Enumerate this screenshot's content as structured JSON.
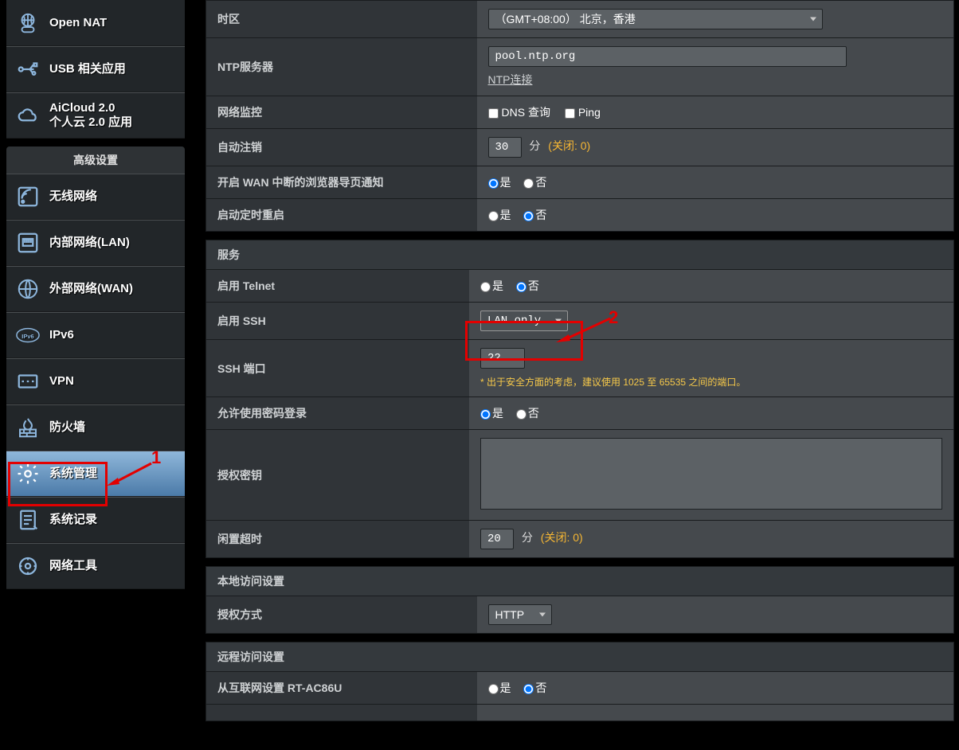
{
  "sidebar": {
    "top_items": [
      {
        "label": "Open NAT",
        "icon": "gamepad-globe-icon"
      },
      {
        "label": "USB 相关应用",
        "icon": "usb-icon"
      },
      {
        "label": "AiCloud 2.0\n个人云 2.0 应用",
        "icon": "cloud-icon"
      }
    ],
    "advanced_header": "高级设置",
    "items": [
      {
        "label": "无线网络",
        "icon": "wifi-icon"
      },
      {
        "label": "内部网络(LAN)",
        "icon": "lan-icon"
      },
      {
        "label": "外部网络(WAN)",
        "icon": "globe-icon"
      },
      {
        "label": "IPv6",
        "icon": "ipv6-icon"
      },
      {
        "label": "VPN",
        "icon": "vpn-icon"
      },
      {
        "label": "防火墙",
        "icon": "firewall-icon"
      },
      {
        "label": "系统管理",
        "icon": "gear-icon"
      },
      {
        "label": "系统记录",
        "icon": "log-icon"
      },
      {
        "label": "网络工具",
        "icon": "tools-icon"
      }
    ],
    "active_index": 6
  },
  "main": {
    "rows": {
      "timezone": {
        "label": "时区",
        "value": "（GMT+08:00） 北京，香港"
      },
      "ntp_server": {
        "label": "NTP服务器",
        "value": "pool.ntp.org",
        "link": "NTP连接"
      },
      "net_monitor": {
        "label": "网络监控",
        "chk1": "DNS 查询",
        "chk2": "Ping"
      },
      "auto_logout": {
        "label": "自动注销",
        "value": "30",
        "unit": "分",
        "hint": "(关闭: 0)"
      },
      "wan_notify": {
        "label": "开启 WAN 中断的浏览器导页通知",
        "yes": "是",
        "no": "否",
        "selected": "yes"
      },
      "sched_reboot": {
        "label": "启动定时重启",
        "yes": "是",
        "no": "否",
        "selected": "no"
      }
    },
    "service_header": "服务",
    "service": {
      "telnet": {
        "label": "启用 Telnet",
        "yes": "是",
        "no": "否",
        "selected": "no"
      },
      "ssh": {
        "label": "启用 SSH",
        "value": "LAN only"
      },
      "ssh_port": {
        "label": "SSH 端口",
        "value": "22",
        "note": "* 出于安全方面的考虑，建议使用 1025 至 65535 之间的端口。"
      },
      "pw_login": {
        "label": "允许使用密码登录",
        "yes": "是",
        "no": "否",
        "selected": "yes"
      },
      "auth_key": {
        "label": "授权密钥",
        "value": ""
      },
      "idle_timeout": {
        "label": "闲置超时",
        "value": "20",
        "unit": "分",
        "hint": "(关闭: 0)"
      }
    },
    "local_header": "本地访问设置",
    "local": {
      "auth_method": {
        "label": "授权方式",
        "value": "HTTP"
      }
    },
    "remote_header": "远程访问设置",
    "remote": {
      "from_internet": {
        "label": "从互联网设置 RT-AC86U",
        "yes": "是",
        "no": "否",
        "selected": "no"
      }
    }
  },
  "annotations": {
    "a1": "1",
    "a2": "2"
  }
}
